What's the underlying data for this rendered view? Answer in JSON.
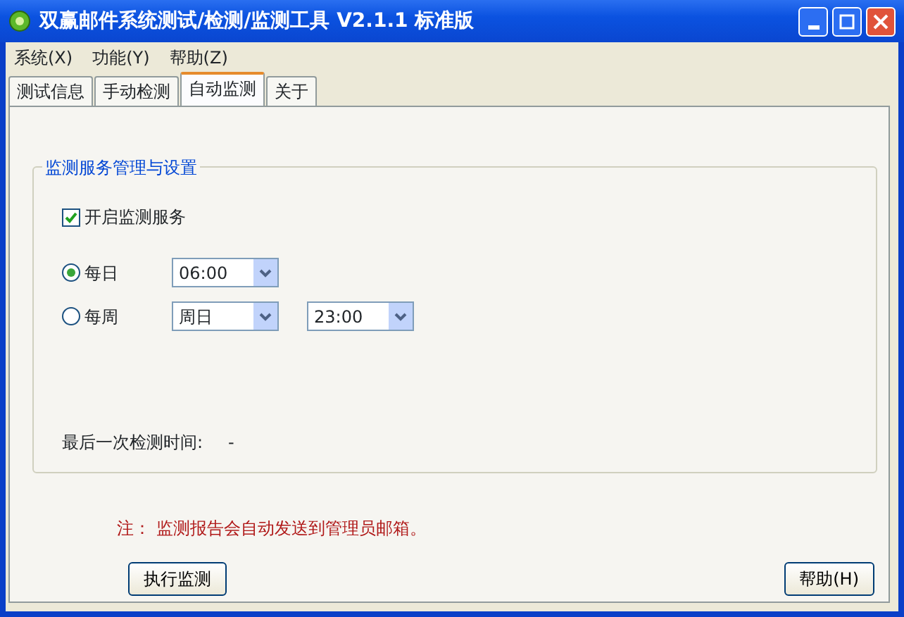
{
  "window": {
    "title": "双赢邮件系统测试/检测/监测工具 V2.1.1 标准版"
  },
  "menu": [
    "系统(X)",
    "功能(Y)",
    "帮助(Z)"
  ],
  "tabs": [
    {
      "label": "测试信息",
      "selected": false
    },
    {
      "label": "手动检测",
      "selected": false
    },
    {
      "label": "自动监测",
      "selected": true
    },
    {
      "label": "关于",
      "selected": false
    }
  ],
  "group": {
    "title": "监测服务管理与设置",
    "enable": {
      "label": "开启监测服务",
      "checked": true
    },
    "schedules": [
      {
        "label": "每日",
        "selected": true,
        "combos": [
          "06:00"
        ]
      },
      {
        "label": "每周",
        "selected": false,
        "combos": [
          "周日",
          "23:00"
        ]
      }
    ],
    "last_check": {
      "label": "最后一次检测时间:",
      "value": "-"
    }
  },
  "note": "注： 监测报告会自动发送到管理员邮箱。",
  "buttons": [
    "执行监测",
    "帮助(H)"
  ]
}
